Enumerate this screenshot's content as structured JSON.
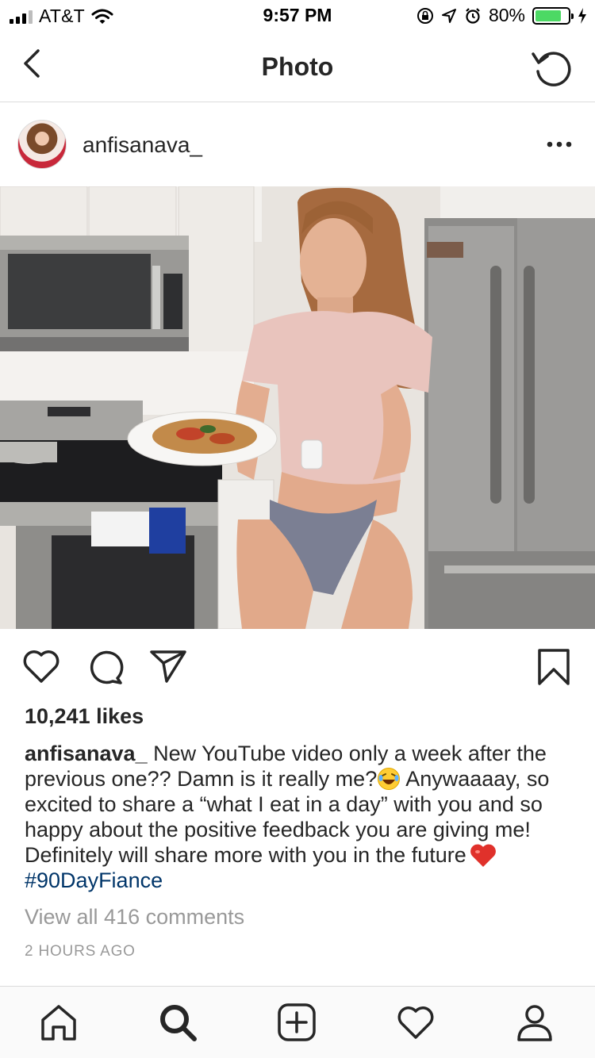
{
  "status_bar": {
    "carrier": "AT&T",
    "time": "9:57 PM",
    "battery_percent": "80%",
    "battery_level": 0.8,
    "icons": [
      "signal-icon",
      "wifi-icon",
      "orientation-lock-icon",
      "location-icon",
      "alarm-icon",
      "battery-icon",
      "charging-icon"
    ]
  },
  "nav": {
    "title": "Photo",
    "back_icon": "chevron-left-icon",
    "refresh_icon": "refresh-icon"
  },
  "post": {
    "username": "anfisanava_",
    "more_icon": "more-dots-icon",
    "likes": "10,241 likes",
    "caption": {
      "username": "anfisanava_",
      "text_1": "New YouTube video only a week after the previous one?? Damn is it really me?",
      "text_2": "Anywaaaay, so excited to share a “what I eat in a day” with you and so happy about the positive feedback you are giving me! Definitely will share more with you in the future",
      "hashtag": "#90DayFiance"
    },
    "view_comments": "View all 416 comments",
    "timestamp": "2 HOURS AGO"
  },
  "actions": [
    "heart-icon",
    "comment-icon",
    "share-icon",
    "bookmark-icon"
  ],
  "tab_bar": [
    "home-icon",
    "search-icon",
    "add-post-icon",
    "activity-heart-icon",
    "profile-icon"
  ],
  "colors": {
    "hashtag": "#003569",
    "battery_fill": "#4cd964",
    "muted_text": "#999999",
    "divider": "#dbdbdb"
  }
}
